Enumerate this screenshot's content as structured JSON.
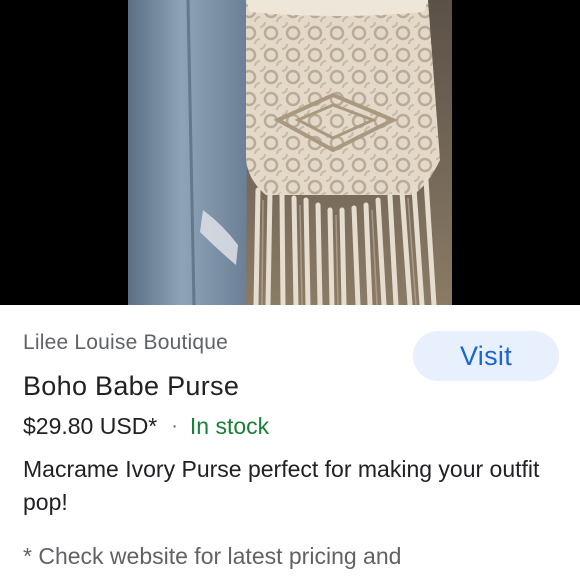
{
  "viewer": {
    "image_subject": "macrame-ivory-purse-photo"
  },
  "product": {
    "merchant": "Lilee Louise Boutique",
    "visit_label": "Visit",
    "title": "Boho Babe Purse",
    "price": "$29.80 USD*",
    "separator": "·",
    "availability": "In stock",
    "description": "Macrame Ivory Purse perfect for making your outfit pop!",
    "pricing_note": "* Check website for latest pricing and"
  },
  "colors": {
    "visit_bg": "#e8f0fe",
    "visit_text": "#1a66d2",
    "in_stock": "#188038",
    "secondary_text": "#5f6368"
  }
}
